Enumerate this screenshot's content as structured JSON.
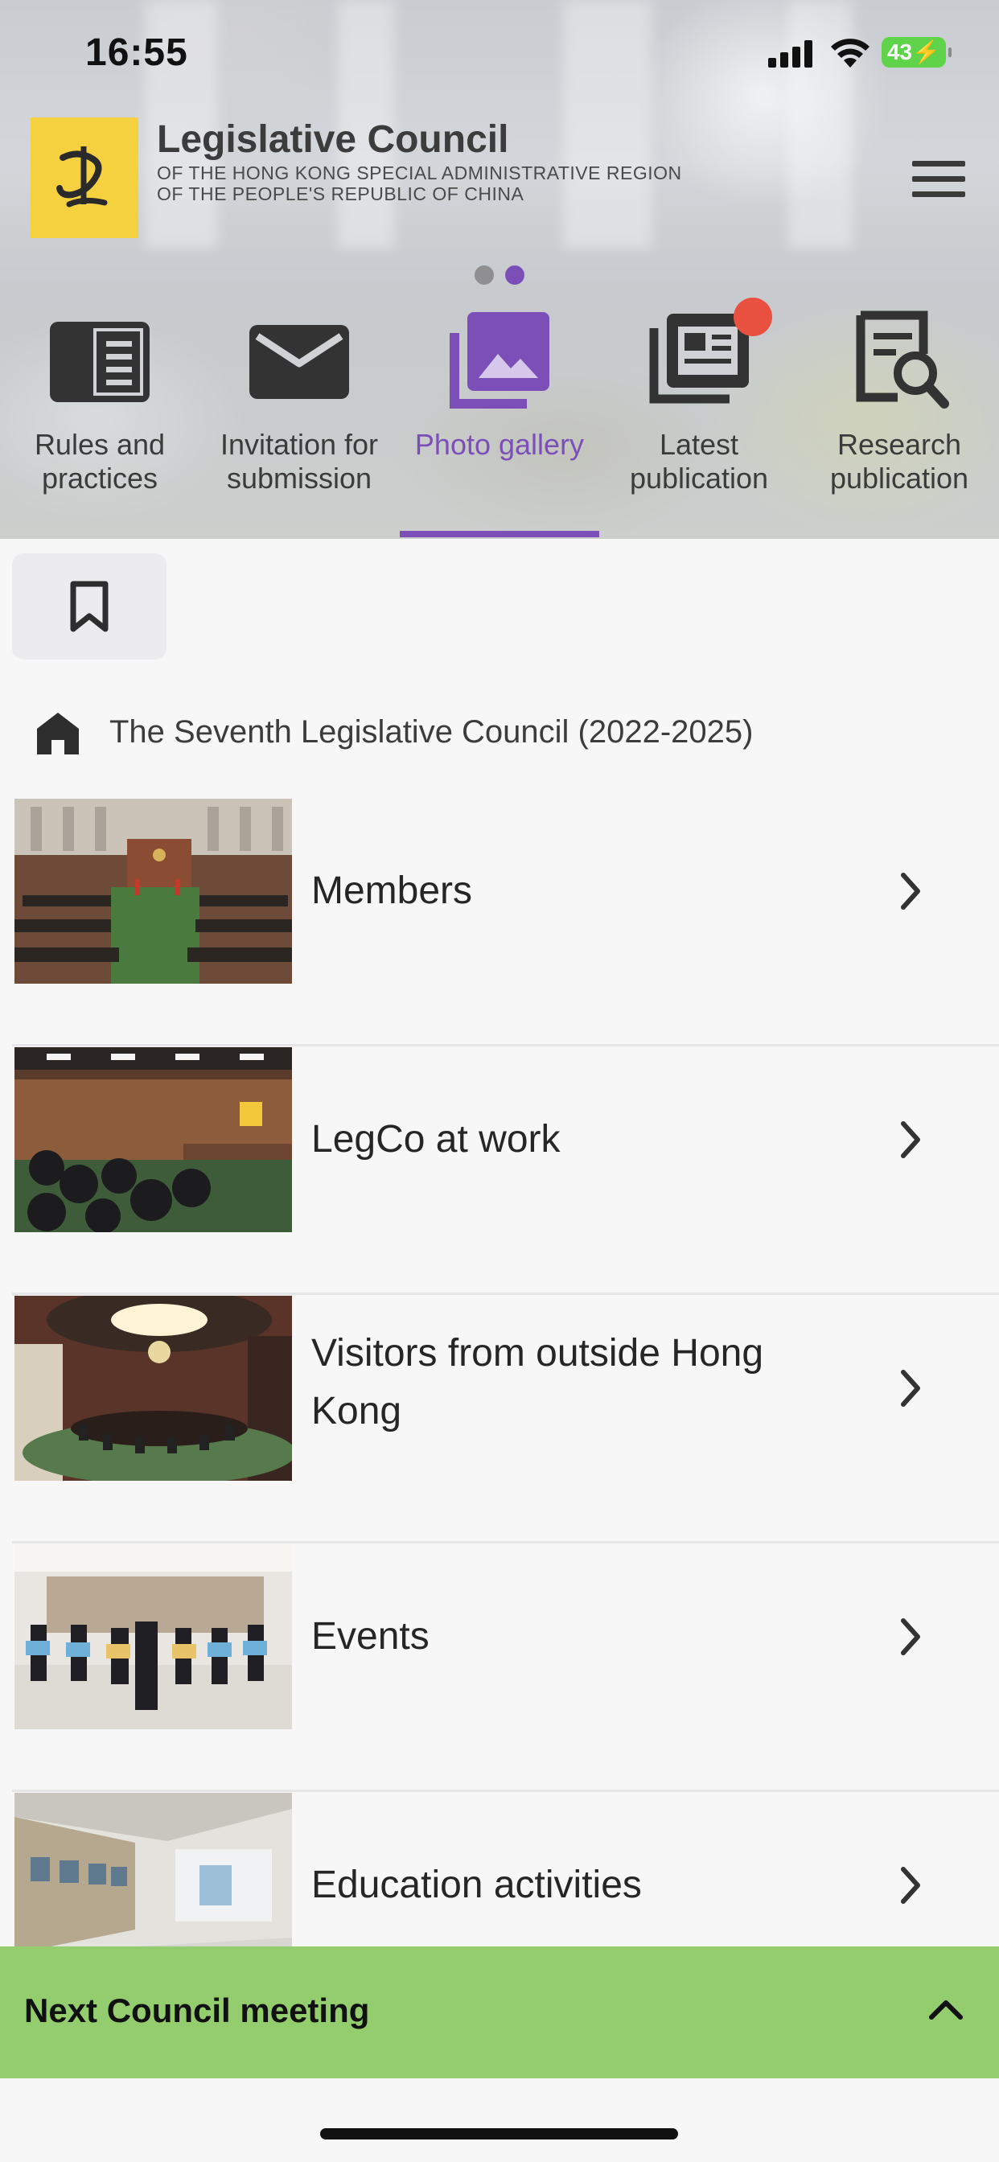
{
  "status_bar": {
    "time": "16:55",
    "battery": "43"
  },
  "header": {
    "title": "Legislative Council",
    "subtitle_line1": "OF THE HONG KONG SPECIAL ADMINISTRATIVE REGION",
    "subtitle_line2": "OF THE PEOPLE'S REPUBLIC OF CHINA",
    "logo_icon": "legco-logo",
    "menu_icon": "hamburger-menu-icon"
  },
  "nav": {
    "active_index": 2,
    "active_color": "#7c4fb8",
    "items": [
      {
        "label": "Rules and practices",
        "icon": "book-icon"
      },
      {
        "label": "Invitation for submission",
        "icon": "envelope-icon"
      },
      {
        "label": "Photo gallery",
        "icon": "photo-gallery-icon"
      },
      {
        "label": "Latest publication",
        "icon": "newspaper-icon"
      },
      {
        "label": "Research publication",
        "icon": "document-search-icon"
      }
    ],
    "notification_badge_color": "#e8503f"
  },
  "bookmark": {
    "icon": "bookmark-icon"
  },
  "breadcrumb": {
    "icon": "home-icon",
    "text": "The Seventh Legislative Council (2022-2025)"
  },
  "gallery_list": [
    {
      "label": "Members"
    },
    {
      "label": "LegCo at work"
    },
    {
      "label": "Visitors from outside Hong Kong"
    },
    {
      "label": "Events"
    },
    {
      "label": "Education activities"
    }
  ],
  "next_meeting": {
    "label": "Next Council meeting",
    "icon": "chevron-up-icon",
    "color": "#93cd6e"
  }
}
